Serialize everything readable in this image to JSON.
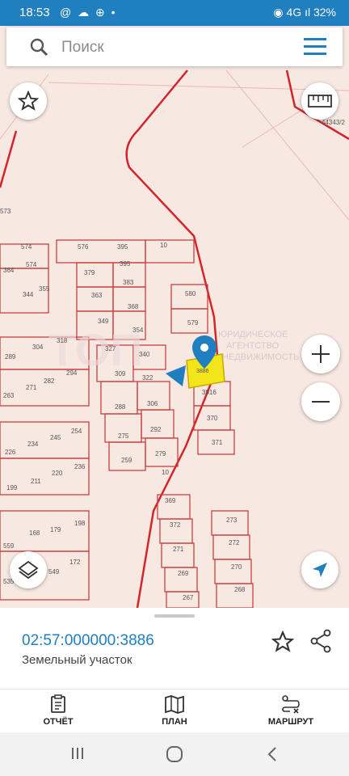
{
  "status": {
    "time": "18:53",
    "left_icons": "@ ☁ ⊕ •",
    "right_icons": "◉ 4G ıl",
    "battery": "32%"
  },
  "search": {
    "placeholder": "Поиск"
  },
  "map": {
    "parcels": [
      "576",
      "395",
      "10",
      "579",
      "379",
      "395",
      "383",
      "363",
      "368",
      "580",
      "349",
      "354",
      "340",
      "327",
      "309",
      "322",
      "288",
      "306",
      "275",
      "292",
      "259",
      "279",
      "10",
      "369",
      "372",
      "271",
      "269",
      "267",
      "273",
      "272",
      "270",
      "268",
      "3916",
      "370",
      "371",
      "3886",
      "574",
      "574",
      "364",
      "344",
      "355",
      "304",
      "289",
      "318",
      "282",
      "294",
      "271",
      "263",
      "234",
      "245",
      "254",
      "226",
      "211",
      "220",
      "236",
      "199",
      "168",
      "179",
      "198",
      "559",
      "549",
      "172",
      "535",
      "573",
      "44343/2"
    ],
    "watermark": "ЮРИДИЧЕСКОЕ АГЕНТСТВО НЕДВИЖИМОСТЬ"
  },
  "selected": {
    "cadastral_number": "02:57:000000:3886",
    "type": "Земельный участок"
  },
  "tabs": [
    {
      "label": "ОТЧЁТ",
      "icon": "report-icon"
    },
    {
      "label": "ПЛАН",
      "icon": "map-icon"
    },
    {
      "label": "МАРШРУТ",
      "icon": "route-icon"
    }
  ],
  "colors": {
    "accent": "#1f7fbf",
    "boundary": "#d4242a",
    "selected": "#f2e51a",
    "map_bg": "#f7e8e2"
  }
}
